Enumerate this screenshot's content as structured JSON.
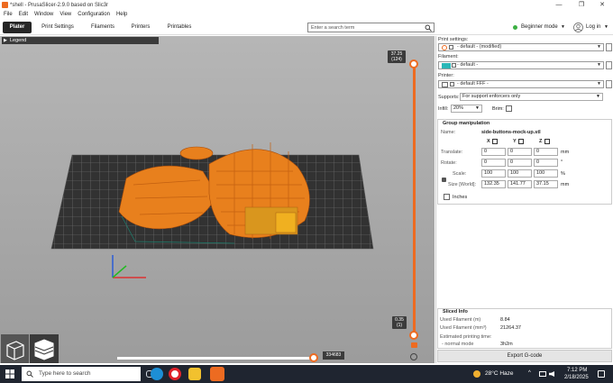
{
  "window": {
    "title": "*shell - PrusaSlicer-2.9.0 based on Slic3r",
    "minimize": "—",
    "maximize": "❐",
    "close": "✕"
  },
  "menu": [
    "File",
    "Edit",
    "Window",
    "View",
    "Configuration",
    "Help"
  ],
  "tabs": [
    "Plater",
    "Print Settings",
    "Filaments",
    "Printers",
    "Printables"
  ],
  "search": {
    "placeholder": "Enter a search term"
  },
  "mode": {
    "label": "Beginner mode",
    "color": "#3cb043"
  },
  "login": {
    "label": "Log in"
  },
  "viewport": {
    "legend": "Legend",
    "layer_top": "37.25",
    "layer_top_count": "(124)",
    "layer_bottom": "0.35",
    "layer_bottom_count": "(1)",
    "moves_count": "334683",
    "accent": "#ed6b21"
  },
  "panel": {
    "print_settings_label": "Print settings:",
    "print_settings_value": "- default - (modified)",
    "filament_label": "Filament:",
    "filament_value": "- default -",
    "filament_color": "#2ab7b7",
    "printer_label": "Printer:",
    "printer_value": "- default FFF -",
    "supports_label": "Supports:",
    "supports_value": "For support enforcers only",
    "infill_label": "Infill:",
    "infill_value": "20%",
    "brim_label": "Brim:",
    "group_title": "Group manipulation",
    "name_label": "Name:",
    "name_value": "side-buttons-mock-up.stl",
    "axis_x": "X",
    "axis_y": "Y",
    "axis_z": "Z",
    "translate_label": "Translate:",
    "translate": [
      "0",
      "0",
      "0"
    ],
    "translate_unit": "mm",
    "rotate_label": "Rotate:",
    "rotate": [
      "0",
      "0",
      "0"
    ],
    "rotate_unit": "°",
    "scale_label": "Scale:",
    "scale": [
      "100",
      "100",
      "100"
    ],
    "scale_unit": "%",
    "size_label": "Size [World]:",
    "size": [
      "132.35",
      "141.77",
      "37.15"
    ],
    "size_unit": "mm",
    "inches_label": "Inches",
    "sliced_title": "Sliced Info",
    "used_m_label": "Used Filament (m)",
    "used_m_value": "8.84",
    "used_mm3_label": "Used Filament (mm³)",
    "used_mm3_value": "21264.37",
    "est_label": "Estimated printing time:",
    "normal_label": "- normal mode",
    "normal_value": "3h2m",
    "export_label": "Export G-code"
  },
  "taskbar": {
    "search_placeholder": "Type here to search",
    "weather": "28°C  Haze",
    "time": "7:12 PM",
    "date": "2/18/2025"
  }
}
